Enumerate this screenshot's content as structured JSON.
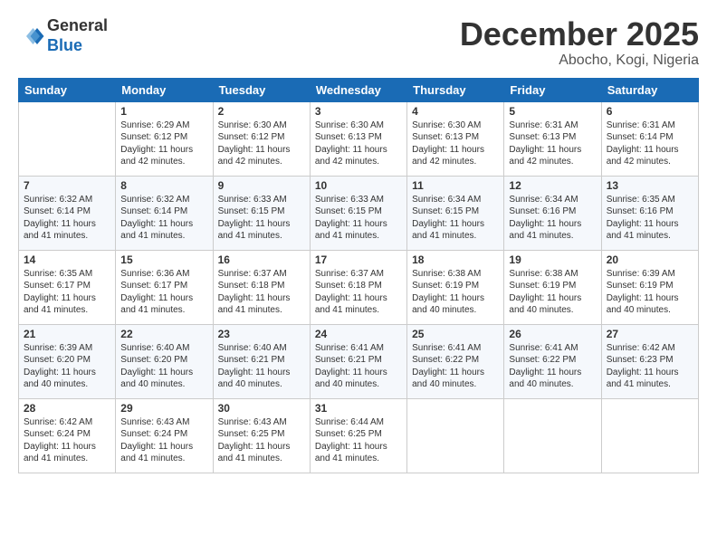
{
  "header": {
    "logo": {
      "general": "General",
      "blue": "Blue"
    },
    "title": "December 2025",
    "subtitle": "Abocho, Kogi, Nigeria"
  },
  "days_of_week": [
    "Sunday",
    "Monday",
    "Tuesday",
    "Wednesday",
    "Thursday",
    "Friday",
    "Saturday"
  ],
  "weeks": [
    [
      {
        "day": "",
        "info": ""
      },
      {
        "day": "1",
        "info": "Sunrise: 6:29 AM\nSunset: 6:12 PM\nDaylight: 11 hours\nand 42 minutes."
      },
      {
        "day": "2",
        "info": "Sunrise: 6:30 AM\nSunset: 6:12 PM\nDaylight: 11 hours\nand 42 minutes."
      },
      {
        "day": "3",
        "info": "Sunrise: 6:30 AM\nSunset: 6:13 PM\nDaylight: 11 hours\nand 42 minutes."
      },
      {
        "day": "4",
        "info": "Sunrise: 6:30 AM\nSunset: 6:13 PM\nDaylight: 11 hours\nand 42 minutes."
      },
      {
        "day": "5",
        "info": "Sunrise: 6:31 AM\nSunset: 6:13 PM\nDaylight: 11 hours\nand 42 minutes."
      },
      {
        "day": "6",
        "info": "Sunrise: 6:31 AM\nSunset: 6:14 PM\nDaylight: 11 hours\nand 42 minutes."
      }
    ],
    [
      {
        "day": "7",
        "info": "Sunrise: 6:32 AM\nSunset: 6:14 PM\nDaylight: 11 hours\nand 41 minutes."
      },
      {
        "day": "8",
        "info": "Sunrise: 6:32 AM\nSunset: 6:14 PM\nDaylight: 11 hours\nand 41 minutes."
      },
      {
        "day": "9",
        "info": "Sunrise: 6:33 AM\nSunset: 6:15 PM\nDaylight: 11 hours\nand 41 minutes."
      },
      {
        "day": "10",
        "info": "Sunrise: 6:33 AM\nSunset: 6:15 PM\nDaylight: 11 hours\nand 41 minutes."
      },
      {
        "day": "11",
        "info": "Sunrise: 6:34 AM\nSunset: 6:15 PM\nDaylight: 11 hours\nand 41 minutes."
      },
      {
        "day": "12",
        "info": "Sunrise: 6:34 AM\nSunset: 6:16 PM\nDaylight: 11 hours\nand 41 minutes."
      },
      {
        "day": "13",
        "info": "Sunrise: 6:35 AM\nSunset: 6:16 PM\nDaylight: 11 hours\nand 41 minutes."
      }
    ],
    [
      {
        "day": "14",
        "info": "Sunrise: 6:35 AM\nSunset: 6:17 PM\nDaylight: 11 hours\nand 41 minutes."
      },
      {
        "day": "15",
        "info": "Sunrise: 6:36 AM\nSunset: 6:17 PM\nDaylight: 11 hours\nand 41 minutes."
      },
      {
        "day": "16",
        "info": "Sunrise: 6:37 AM\nSunset: 6:18 PM\nDaylight: 11 hours\nand 41 minutes."
      },
      {
        "day": "17",
        "info": "Sunrise: 6:37 AM\nSunset: 6:18 PM\nDaylight: 11 hours\nand 41 minutes."
      },
      {
        "day": "18",
        "info": "Sunrise: 6:38 AM\nSunset: 6:19 PM\nDaylight: 11 hours\nand 40 minutes."
      },
      {
        "day": "19",
        "info": "Sunrise: 6:38 AM\nSunset: 6:19 PM\nDaylight: 11 hours\nand 40 minutes."
      },
      {
        "day": "20",
        "info": "Sunrise: 6:39 AM\nSunset: 6:19 PM\nDaylight: 11 hours\nand 40 minutes."
      }
    ],
    [
      {
        "day": "21",
        "info": "Sunrise: 6:39 AM\nSunset: 6:20 PM\nDaylight: 11 hours\nand 40 minutes."
      },
      {
        "day": "22",
        "info": "Sunrise: 6:40 AM\nSunset: 6:20 PM\nDaylight: 11 hours\nand 40 minutes."
      },
      {
        "day": "23",
        "info": "Sunrise: 6:40 AM\nSunset: 6:21 PM\nDaylight: 11 hours\nand 40 minutes."
      },
      {
        "day": "24",
        "info": "Sunrise: 6:41 AM\nSunset: 6:21 PM\nDaylight: 11 hours\nand 40 minutes."
      },
      {
        "day": "25",
        "info": "Sunrise: 6:41 AM\nSunset: 6:22 PM\nDaylight: 11 hours\nand 40 minutes."
      },
      {
        "day": "26",
        "info": "Sunrise: 6:41 AM\nSunset: 6:22 PM\nDaylight: 11 hours\nand 40 minutes."
      },
      {
        "day": "27",
        "info": "Sunrise: 6:42 AM\nSunset: 6:23 PM\nDaylight: 11 hours\nand 41 minutes."
      }
    ],
    [
      {
        "day": "28",
        "info": "Sunrise: 6:42 AM\nSunset: 6:24 PM\nDaylight: 11 hours\nand 41 minutes."
      },
      {
        "day": "29",
        "info": "Sunrise: 6:43 AM\nSunset: 6:24 PM\nDaylight: 11 hours\nand 41 minutes."
      },
      {
        "day": "30",
        "info": "Sunrise: 6:43 AM\nSunset: 6:25 PM\nDaylight: 11 hours\nand 41 minutes."
      },
      {
        "day": "31",
        "info": "Sunrise: 6:44 AM\nSunset: 6:25 PM\nDaylight: 11 hours\nand 41 minutes."
      },
      {
        "day": "",
        "info": ""
      },
      {
        "day": "",
        "info": ""
      },
      {
        "day": "",
        "info": ""
      }
    ]
  ]
}
